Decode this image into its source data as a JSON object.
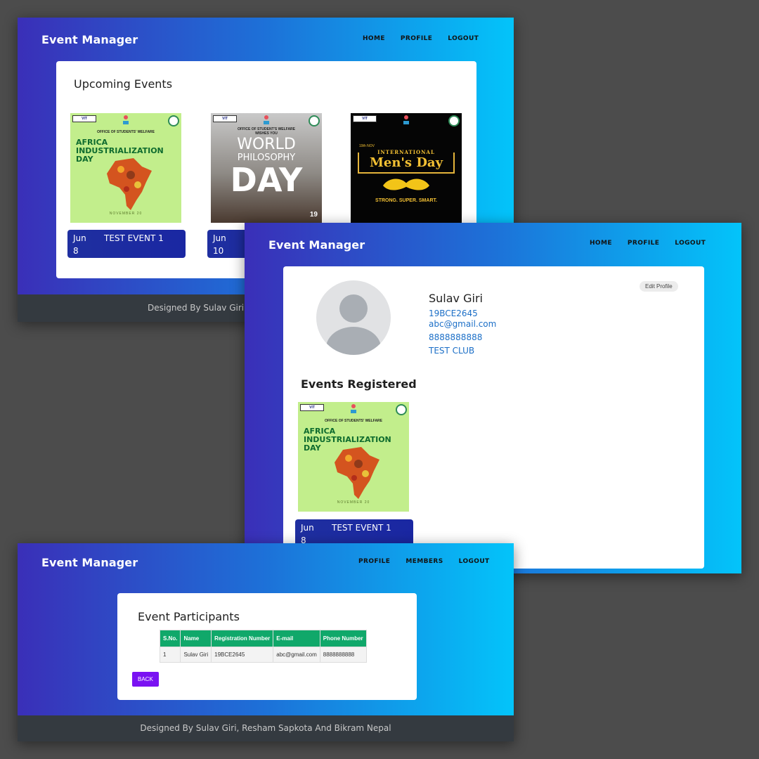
{
  "brand": "Event Manager",
  "nav_main": [
    "HOME",
    "PROFILE",
    "LOGOUT"
  ],
  "nav_admin": [
    "PROFILE",
    "MEMBERS",
    "LOGOUT"
  ],
  "upcoming": {
    "title": "Upcoming Events",
    "events": [
      {
        "month": "Jun",
        "day": "8",
        "name": "TEST EVENT 1"
      },
      {
        "month": "Jun",
        "day": "10",
        "name": ""
      }
    ]
  },
  "posters": {
    "africa": {
      "head": "VIT",
      "osw": "OFFICE OF STUDENTS' WELFARE",
      "lines": [
        "AFRICA",
        "INDUSTRIALIZATION",
        "DAY"
      ],
      "date": "NOVEMBER 20"
    },
    "philosophy": {
      "osw": "OFFICE OF STUDENT'S WELFARE",
      "wishes": "WISHES YOU",
      "l1": "WORLD",
      "l2": "PHILOSOPHY",
      "l3": "DAY",
      "num": "19"
    },
    "mens": {
      "date": "19th NOV",
      "small": "INTERNATIONAL",
      "title": "Men's Day",
      "tag": "STRONG. SUPER. SMART."
    }
  },
  "profile": {
    "name": "Sulav Giri",
    "reg": "19BCE2645",
    "email": "abc@gmail.com",
    "phone": "8888888888",
    "club": "TEST CLUB",
    "edit_label": "Edit Profile",
    "registered_title": "Events Registered",
    "registered_event": {
      "month": "Jun",
      "day": "8",
      "name": "TEST EVENT 1"
    }
  },
  "participants": {
    "title": "Event Participants",
    "columns": [
      "S.No.",
      "Name",
      "Registration Number",
      "E-mail",
      "Phone Number"
    ],
    "rows": [
      [
        "1",
        "Sulav Giri",
        "19BCE2645",
        "abc@gmail.com",
        "8888888888"
      ]
    ],
    "back_label": "BACK"
  },
  "footer_partial": "Designed By Sulav Giri, R",
  "footer": "Designed By Sulav Giri, Resham Sapkota And Bikram Nepal"
}
